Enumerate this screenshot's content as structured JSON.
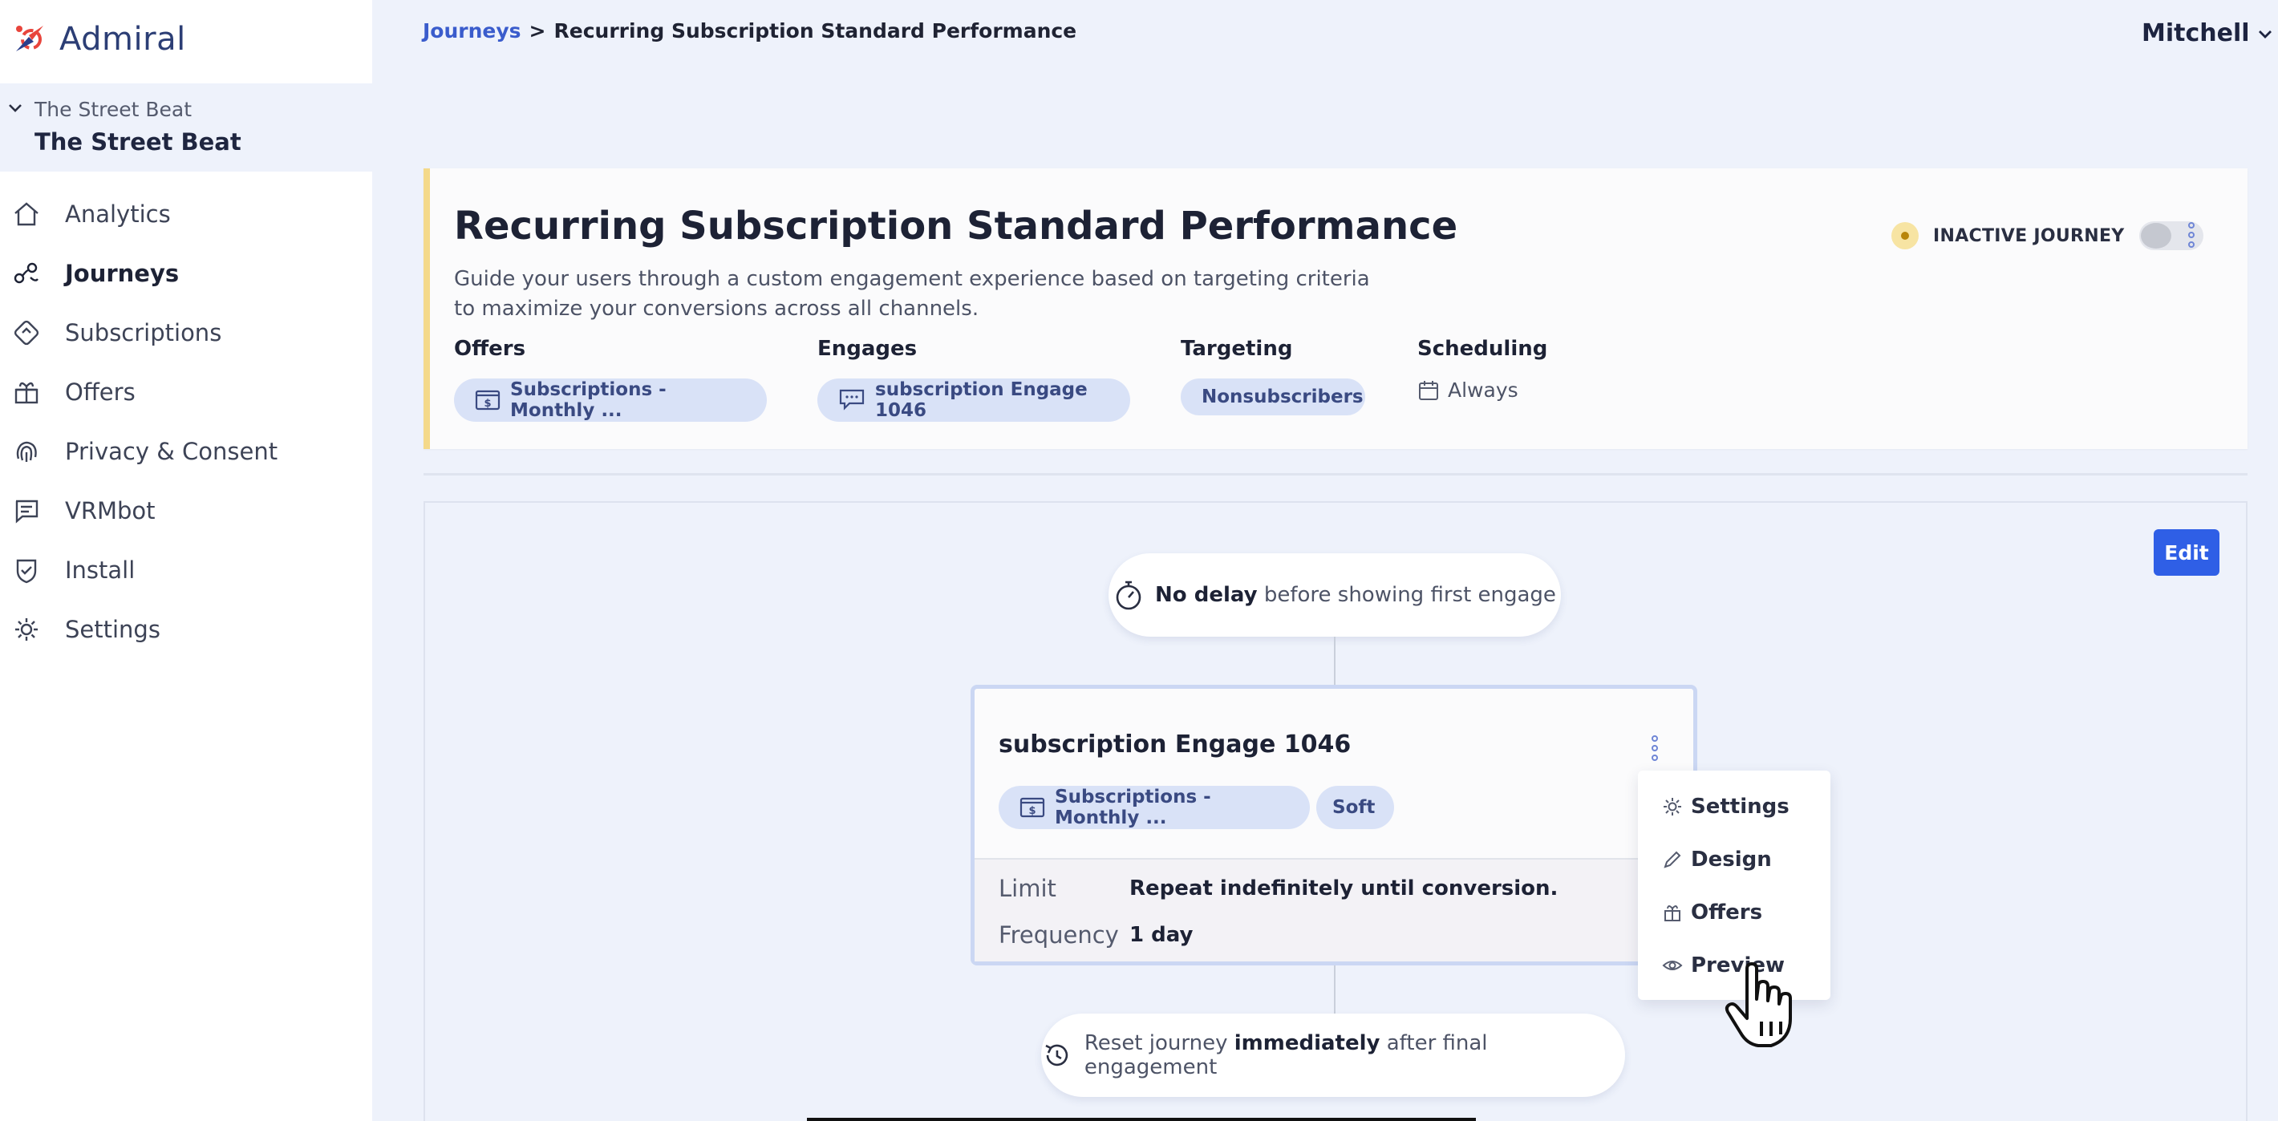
{
  "brand": {
    "name": "Admiral"
  },
  "account": {
    "org_small": "The Street Beat",
    "org_big": "The Street Beat"
  },
  "nav": {
    "items": [
      {
        "label": "Analytics",
        "icon": "home-icon"
      },
      {
        "label": "Journeys",
        "icon": "journeys-icon",
        "active": true
      },
      {
        "label": "Subscriptions",
        "icon": "subscriptions-icon"
      },
      {
        "label": "Offers",
        "icon": "gift-icon"
      },
      {
        "label": "Privacy & Consent",
        "icon": "fingerprint-icon"
      },
      {
        "label": "VRMbot",
        "icon": "chat-icon"
      },
      {
        "label": "Install",
        "icon": "shield-check-icon"
      },
      {
        "label": "Settings",
        "icon": "gear-icon"
      }
    ]
  },
  "breadcrumb": {
    "parent": "Journeys",
    "separator": ">",
    "current": "Recurring Subscription Standard Performance"
  },
  "user": {
    "name": "Mitchell"
  },
  "journey": {
    "title": "Recurring Subscription Standard Performance",
    "description": "Guide your users through a custom engagement experience based on targeting criteria to maximize your conversions across all channels.",
    "status": "INACTIVE JOURNEY",
    "active": false,
    "columns": {
      "offers": {
        "label": "Offers",
        "pill": "Subscriptions - Monthly ..."
      },
      "engages": {
        "label": "Engages",
        "pill": "subscription Engage 1046"
      },
      "targeting": {
        "label": "Targeting",
        "pill": "Nonsubscribers"
      },
      "scheduling": {
        "label": "Scheduling",
        "value": "Always"
      }
    }
  },
  "canvas": {
    "edit_label": "Edit",
    "delay": {
      "bold": "No delay",
      "rest": "before showing first engage"
    },
    "engage": {
      "title": "subscription Engage 1046",
      "offer_pill": "Subscriptions - Monthly ...",
      "type_pill": "Soft",
      "limit_label": "Limit",
      "limit_value": "Repeat indefinitely until conversion.",
      "frequency_label": "Frequency",
      "frequency_value": "1 day"
    },
    "reset": {
      "pre": "Reset journey",
      "bold": "immediately",
      "post": "after final engagement"
    }
  },
  "context_menu": {
    "items": [
      {
        "label": "Settings",
        "icon": "gear-icon"
      },
      {
        "label": "Design",
        "icon": "pen-icon"
      },
      {
        "label": "Offers",
        "icon": "gift-icon"
      },
      {
        "label": "Preview",
        "icon": "eye-icon"
      }
    ]
  },
  "colors": {
    "accent": "#2f5fe6",
    "pill_bg": "#d9e2f7",
    "status_warning": "#f4d98a",
    "link": "#3a5ccc"
  }
}
